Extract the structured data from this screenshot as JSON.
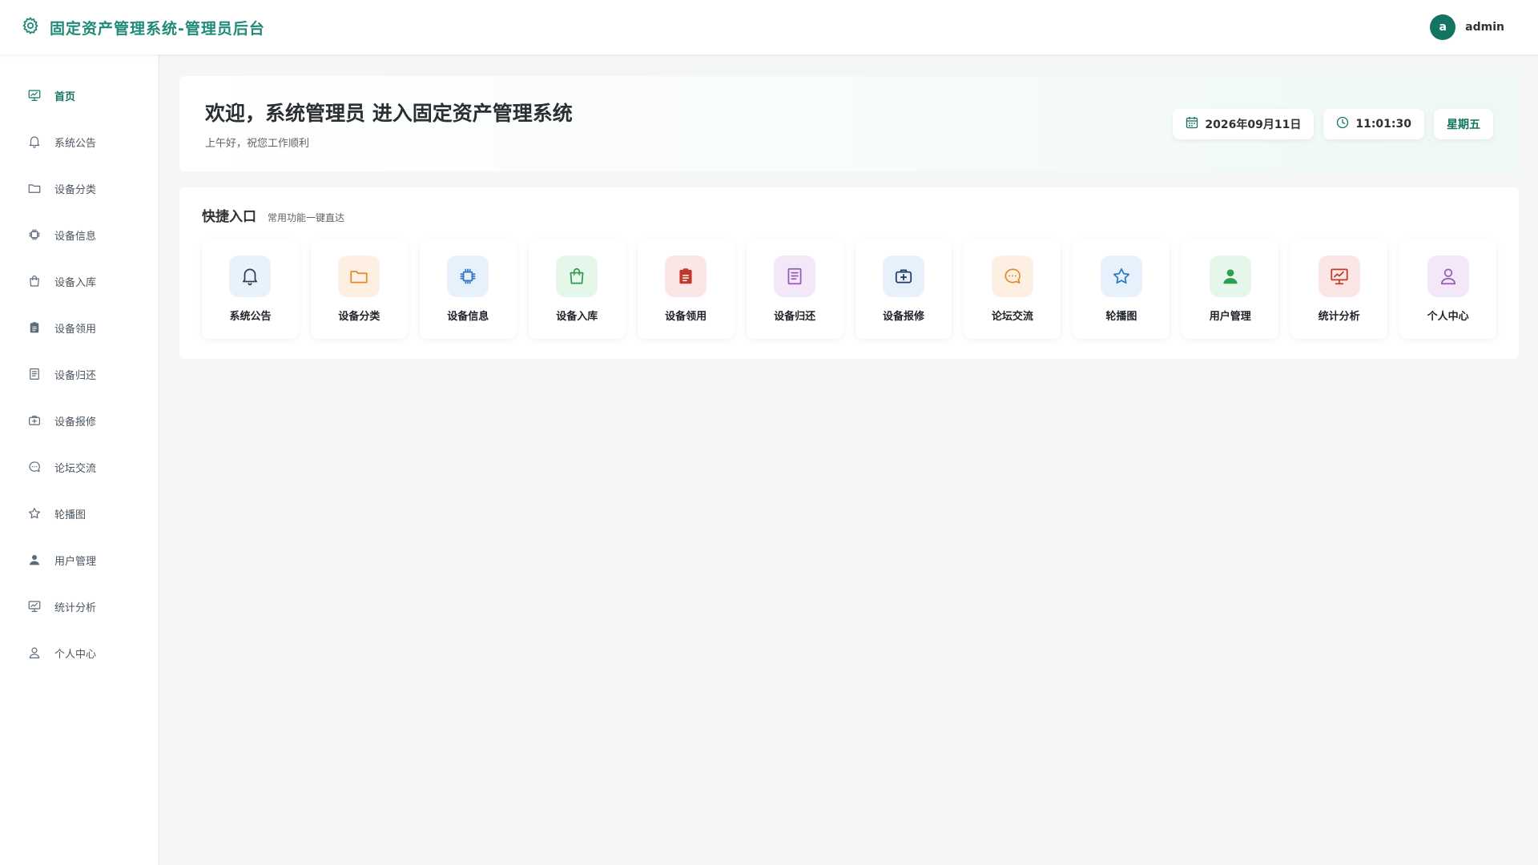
{
  "header": {
    "title": "固定资产管理系统-管理员后台",
    "avatar_letter": "a",
    "username": "admin"
  },
  "sidebar": {
    "items": [
      {
        "label": "首页",
        "icon": "chart-board-icon",
        "active": true
      },
      {
        "label": "系统公告",
        "icon": "bell-icon"
      },
      {
        "label": "设备分类",
        "icon": "folder-icon"
      },
      {
        "label": "设备信息",
        "icon": "chip-icon"
      },
      {
        "label": "设备入库",
        "icon": "bag-icon"
      },
      {
        "label": "设备领用",
        "icon": "clipboard-icon"
      },
      {
        "label": "设备归还",
        "icon": "document-icon"
      },
      {
        "label": "设备报修",
        "icon": "medkit-icon"
      },
      {
        "label": "论坛交流",
        "icon": "chat-icon"
      },
      {
        "label": "轮播图",
        "icon": "star-icon"
      },
      {
        "label": "用户管理",
        "icon": "user-filled-icon"
      },
      {
        "label": "统计分析",
        "icon": "chart-board-icon"
      },
      {
        "label": "个人中心",
        "icon": "user-icon"
      }
    ]
  },
  "welcome": {
    "title": "欢迎，系统管理员 进入固定资产管理系统",
    "subtitle": "上午好，祝您工作顺利",
    "date": "2026年09月11日",
    "time": "11:01:30",
    "weekday": "星期五"
  },
  "quick": {
    "title": "快捷入口",
    "subtitle": "常用功能一键直达",
    "cards": [
      {
        "label": "系统公告",
        "icon": "bell-icon",
        "bg": "#e8f2fb",
        "color": "#2c3e50"
      },
      {
        "label": "设备分类",
        "icon": "folder-icon",
        "bg": "#fdf0e2",
        "color": "#e08a2e"
      },
      {
        "label": "设备信息",
        "icon": "chip-icon",
        "bg": "#e6f1fb",
        "color": "#2f78c4"
      },
      {
        "label": "设备入库",
        "icon": "bag-icon",
        "bg": "#e5f6ea",
        "color": "#2e9e4f"
      },
      {
        "label": "设备领用",
        "icon": "clipboard-icon",
        "bg": "#fbe6e6",
        "color": "#c0392b"
      },
      {
        "label": "设备归还",
        "icon": "document-icon",
        "bg": "#f3e8f7",
        "color": "#9b59b6"
      },
      {
        "label": "设备报修",
        "icon": "medkit-icon",
        "bg": "#e6f1fb",
        "color": "#1e3a5f"
      },
      {
        "label": "论坛交流",
        "icon": "chat-icon",
        "bg": "#fdf0e2",
        "color": "#e08a2e"
      },
      {
        "label": "轮播图",
        "icon": "star-icon",
        "bg": "#e6f1fb",
        "color": "#2f78c4"
      },
      {
        "label": "用户管理",
        "icon": "user-filled-icon",
        "bg": "#e5f6ea",
        "color": "#2e9e4f"
      },
      {
        "label": "统计分析",
        "icon": "chart-board-icon",
        "bg": "#fbe6e6",
        "color": "#c0392b"
      },
      {
        "label": "个人中心",
        "icon": "user-icon",
        "bg": "#f3e8f7",
        "color": "#9b59b6"
      }
    ]
  },
  "colors": {
    "brand": "#1f8a78",
    "accent": "#137561"
  }
}
